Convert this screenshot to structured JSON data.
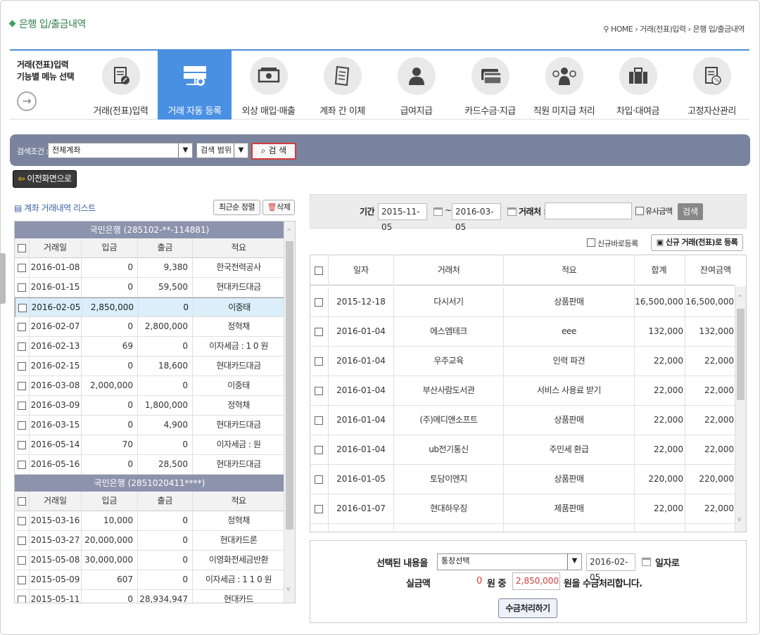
{
  "page": {
    "title": "은행 입/출금내역"
  },
  "breadcrumb": {
    "home": "HOME",
    "level1": "거래(전표)입력",
    "level2": "은행 입/출금내역"
  },
  "menu": {
    "label_line1": "거래(전표)입력",
    "label_line2": "기능별 메뉴 선택",
    "items": [
      {
        "label": "거래(전표)입력",
        "icon": "document-edit-icon"
      },
      {
        "label": "거래 자동 등록",
        "icon": "server-auto-icon"
      },
      {
        "label": "외상 매입·매출",
        "icon": "cash-icon"
      },
      {
        "label": "계좌 간 이체",
        "icon": "receipt-icon"
      },
      {
        "label": "급여지급",
        "icon": "person-icon"
      },
      {
        "label": "카드수금·지급",
        "icon": "credit-card-icon"
      },
      {
        "label": "직원 미지급 처리",
        "icon": "employee-money-icon"
      },
      {
        "label": "차입·대여금",
        "icon": "briefcase-icon"
      },
      {
        "label": "고정자산관리",
        "icon": "asset-document-icon"
      }
    ],
    "active_index": 1
  },
  "search": {
    "label": "검색조건 :",
    "account": "전체계좌",
    "range": "검색 범위",
    "button": "검 색"
  },
  "back_button": "이전화면으로",
  "left_list": {
    "title": "계좌 거래내역 리스트",
    "sort_button": "최근순 정렬",
    "delete_button": "삭제",
    "columns": [
      "거래일",
      "입금",
      "출금",
      "적요"
    ],
    "groups": [
      {
        "bank": "국민은행 (285102-**-114881)",
        "rows": [
          [
            "2016-01-08",
            "0",
            "9,380",
            "한국전력공사"
          ],
          [
            "2016-01-15",
            "0",
            "59,500",
            "현대카드대금"
          ],
          [
            "2016-02-05",
            "2,850,000",
            "0",
            "이중태"
          ],
          [
            "2016-02-07",
            "0",
            "2,800,000",
            "정혁채"
          ],
          [
            "2016-02-13",
            "69",
            "0",
            "이자세금 : 1 0 원"
          ],
          [
            "2016-02-15",
            "0",
            "18,600",
            "현대카드대금"
          ],
          [
            "2016-03-08",
            "2,000,000",
            "0",
            "이중태"
          ],
          [
            "2016-03-09",
            "0",
            "1,800,000",
            "정혁채"
          ],
          [
            "2016-03-15",
            "0",
            "4,900",
            "현대카드대금"
          ],
          [
            "2016-05-14",
            "70",
            "0",
            "이자세금 : 원"
          ],
          [
            "2016-05-16",
            "0",
            "28,500",
            "현대카드대금"
          ]
        ]
      },
      {
        "bank": "국민은행 (2851020411****)",
        "rows": [
          [
            "2015-03-16",
            "10,000",
            "0",
            "정혁채"
          ],
          [
            "2015-03-27",
            "20,000,000",
            "0",
            "현대카드론"
          ],
          [
            "2015-05-08",
            "30,000,000",
            "0",
            "이영화전세금반환"
          ],
          [
            "2015-05-09",
            "607",
            "0",
            "이자세금 : 1 1 0 원"
          ],
          [
            "2015-05-11",
            "0",
            "28,934,947",
            "현대카드"
          ]
        ]
      }
    ]
  },
  "filter": {
    "period_label": "기간 :",
    "from": "2015-11-05",
    "to": "2016-03-05",
    "tilde": "~",
    "partner_label": "거래처 :",
    "partner_value": "",
    "similar_label": "유사금액",
    "search_button": "검색"
  },
  "new_register": {
    "checkbox_label": "신규바로등록",
    "button": "신규 거래(전표)로 등록"
  },
  "right_table": {
    "columns": [
      "일자",
      "거래처",
      "적요",
      "합계",
      "잔여금액"
    ],
    "rows": [
      [
        "2015-12-18",
        "다시서기",
        "상품판매",
        "16,500,000",
        "16,500,000"
      ],
      [
        "2016-01-04",
        "에스엠테크",
        "eee",
        "132,000",
        "132,000"
      ],
      [
        "2016-01-04",
        "우주교육",
        "인력 파견",
        "22,000",
        "22,000"
      ],
      [
        "2016-01-04",
        "부산사람도서관",
        "서비스 사용료 받기",
        "22,000",
        "22,000"
      ],
      [
        "2016-01-04",
        "(주)메디앤소프트",
        "상품판매",
        "22,000",
        "22,000"
      ],
      [
        "2016-01-04",
        "ub전기통신",
        "주민세 환급",
        "22,000",
        "22,000"
      ],
      [
        "2016-01-05",
        "토담이엔지",
        "상품판매",
        "220,000",
        "220,000"
      ],
      [
        "2016-01-07",
        "현대하우징",
        "제품판매",
        "22,000",
        "22,000"
      ]
    ]
  },
  "bottom": {
    "selected_label": "선택된 내용을",
    "select_value": "통장선택",
    "date_value": "2016-02-05",
    "date_suffix": "일자로",
    "amount_label": "실금액",
    "amount_value": "0",
    "won_mid": "원 중",
    "total_value": "2,850,000",
    "won_end": "원을 수금처리합니다.",
    "process_button": "수금처리하기"
  },
  "colors": {
    "accent": "#4a90e2",
    "title_green": "#2f7d4a",
    "search_bar": "#7b849e",
    "red": "#d53b3b"
  }
}
